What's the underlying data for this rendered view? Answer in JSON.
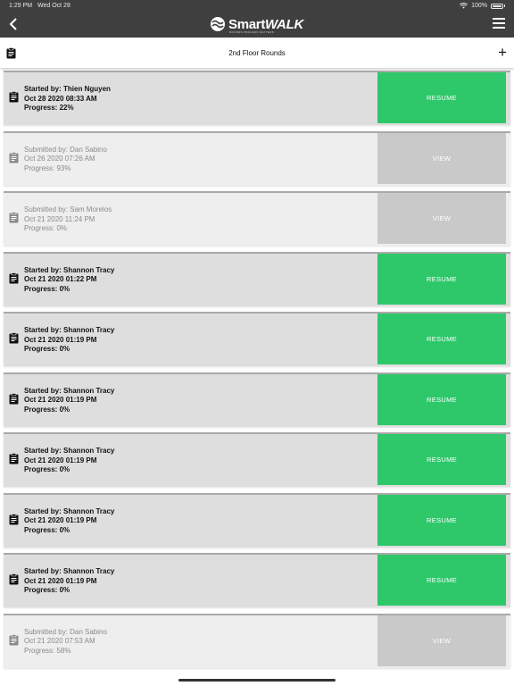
{
  "status_bar": {
    "time": "1:29 PM",
    "date": "Wed Oct 28",
    "battery": "100%"
  },
  "nav": {
    "logo_text_a": "Smart",
    "logo_text_b": "WALK",
    "logo_tagline": "ROUNDS PROCESS MATTERS"
  },
  "header": {
    "title": "2nd Floor Rounds"
  },
  "rows": [
    {
      "status": "started",
      "line1": "Started by: Thien Nguyen",
      "line2": "Oct 28 2020 08:33 AM",
      "line3": "Progress: 22%",
      "action": "RESUME"
    },
    {
      "status": "submitted",
      "line1": "Submitted by: Dan Sabino",
      "line2": "Oct 26 2020 07:26 AM",
      "line3": "Progress: 93%",
      "action": "VIEW"
    },
    {
      "status": "submitted",
      "line1": "Submitted by: Sam Morelos",
      "line2": "Oct 21 2020 11:24 PM",
      "line3": "Progress: 0%",
      "action": "VIEW"
    },
    {
      "status": "started",
      "line1": "Started by: Shannon Tracy",
      "line2": "Oct 21 2020 01:22 PM",
      "line3": "Progress: 0%",
      "action": "RESUME"
    },
    {
      "status": "started",
      "line1": "Started by: Shannon Tracy",
      "line2": "Oct 21 2020 01:19 PM",
      "line3": "Progress: 0%",
      "action": "RESUME"
    },
    {
      "status": "started",
      "line1": "Started by: Shannon Tracy",
      "line2": "Oct 21 2020 01:19 PM",
      "line3": "Progress: 0%",
      "action": "RESUME"
    },
    {
      "status": "started",
      "line1": "Started by: Shannon Tracy",
      "line2": "Oct 21 2020 01:19 PM",
      "line3": "Progress: 0%",
      "action": "RESUME"
    },
    {
      "status": "started",
      "line1": "Started by: Shannon Tracy",
      "line2": "Oct 21 2020 01:19 PM",
      "line3": "Progress: 0%",
      "action": "RESUME"
    },
    {
      "status": "started",
      "line1": "Started by: Shannon Tracy",
      "line2": "Oct 21 2020 01:19 PM",
      "line3": "Progress: 0%",
      "action": "RESUME"
    },
    {
      "status": "submitted",
      "line1": "Submitted by: Dan Sabino",
      "line2": "Oct 21 2020 07:53 AM",
      "line3": "Progress: 58%",
      "action": "VIEW"
    }
  ],
  "colors": {
    "nav_bg": "#3f3f3f",
    "resume_green": "#2ec86a",
    "view_gray": "#c9c9c9"
  }
}
